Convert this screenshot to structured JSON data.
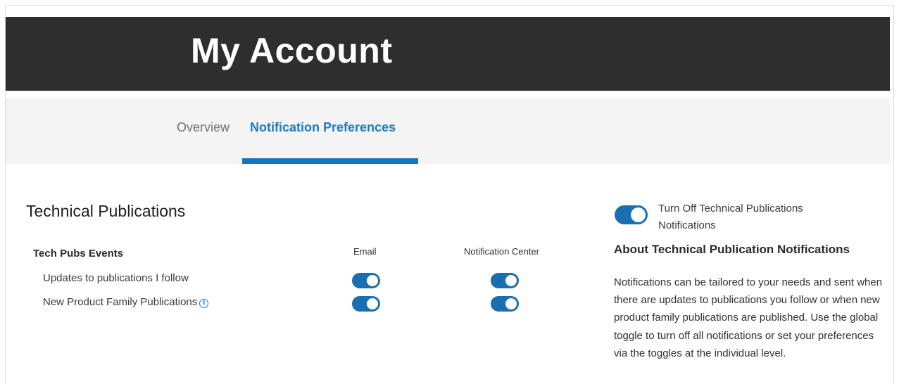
{
  "header": {
    "title": "My Account"
  },
  "tabs": [
    {
      "label": "Overview",
      "active": false
    },
    {
      "label": "Notification Preferences",
      "active": true
    }
  ],
  "section": {
    "title": "Technical Publications",
    "events_title": "Tech Pubs Events",
    "columns": [
      "Email",
      "Notification Center"
    ],
    "rows": [
      {
        "label": "Updates to publications I follow",
        "email": true,
        "notification_center": true,
        "info_icon": false
      },
      {
        "label": "New Product Family Publications",
        "email": true,
        "notification_center": true,
        "info_icon": true
      }
    ]
  },
  "global_toggle": {
    "label": "Turn Off Technical Publications Notifications",
    "on": true
  },
  "about": {
    "title": "About Technical Publication Notifications",
    "text": "Notifications can be tailored to your needs and sent when there are updates to publications you follow or when new product family publications are published. Use the global toggle to turn off all notifications or set your preferences via the toggles at the individual level."
  },
  "colors": {
    "accent": "#1279c0",
    "toggle_on": "#1a6fb0",
    "hero_bg": "#2e2e2e",
    "tabbar_bg": "#f4f4f4"
  }
}
